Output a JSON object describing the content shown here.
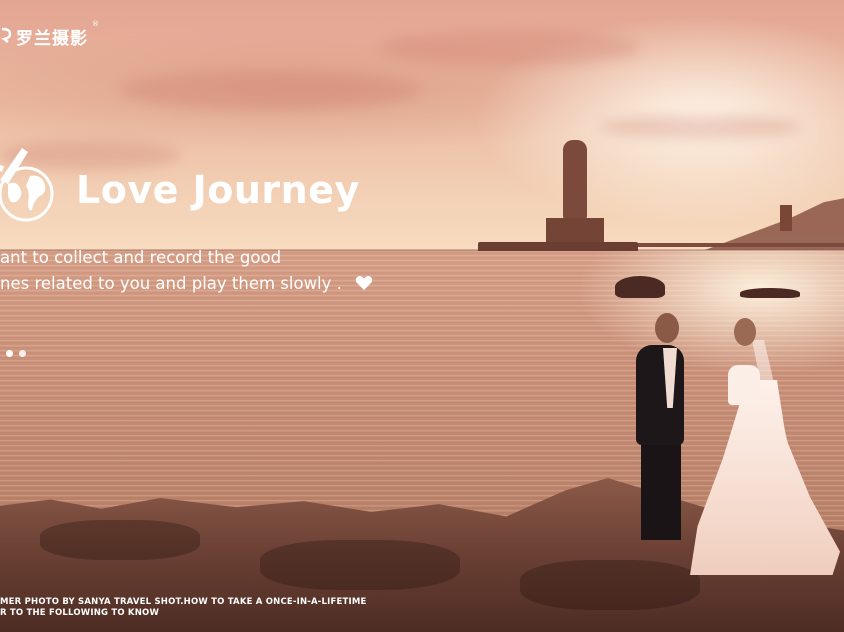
{
  "brand": {
    "logo_text": "罗兰摄影",
    "logo_icon": "logo-mark-icon",
    "registered": "®"
  },
  "hero": {
    "title": "Love Journey",
    "icon": "globe-plane-icon",
    "tagline_lines": [
      "ant to collect and record the good",
      "nes related to you and play them slowly ."
    ],
    "heart_icon": "heart-icon"
  },
  "carousel": {
    "dot_count": 2,
    "active_index": 0
  },
  "footer": {
    "lines": [
      "MER PHOTO BY SANYA TRAVEL SHOT.HOW TO TAKE A ONCE-IN-A-LIFETIME",
      "R TO THE FOLLOWING TO KNOW"
    ]
  },
  "colors": {
    "text": "#ffffff",
    "sky_top": "#e3a592",
    "sea": "#c98f78"
  }
}
